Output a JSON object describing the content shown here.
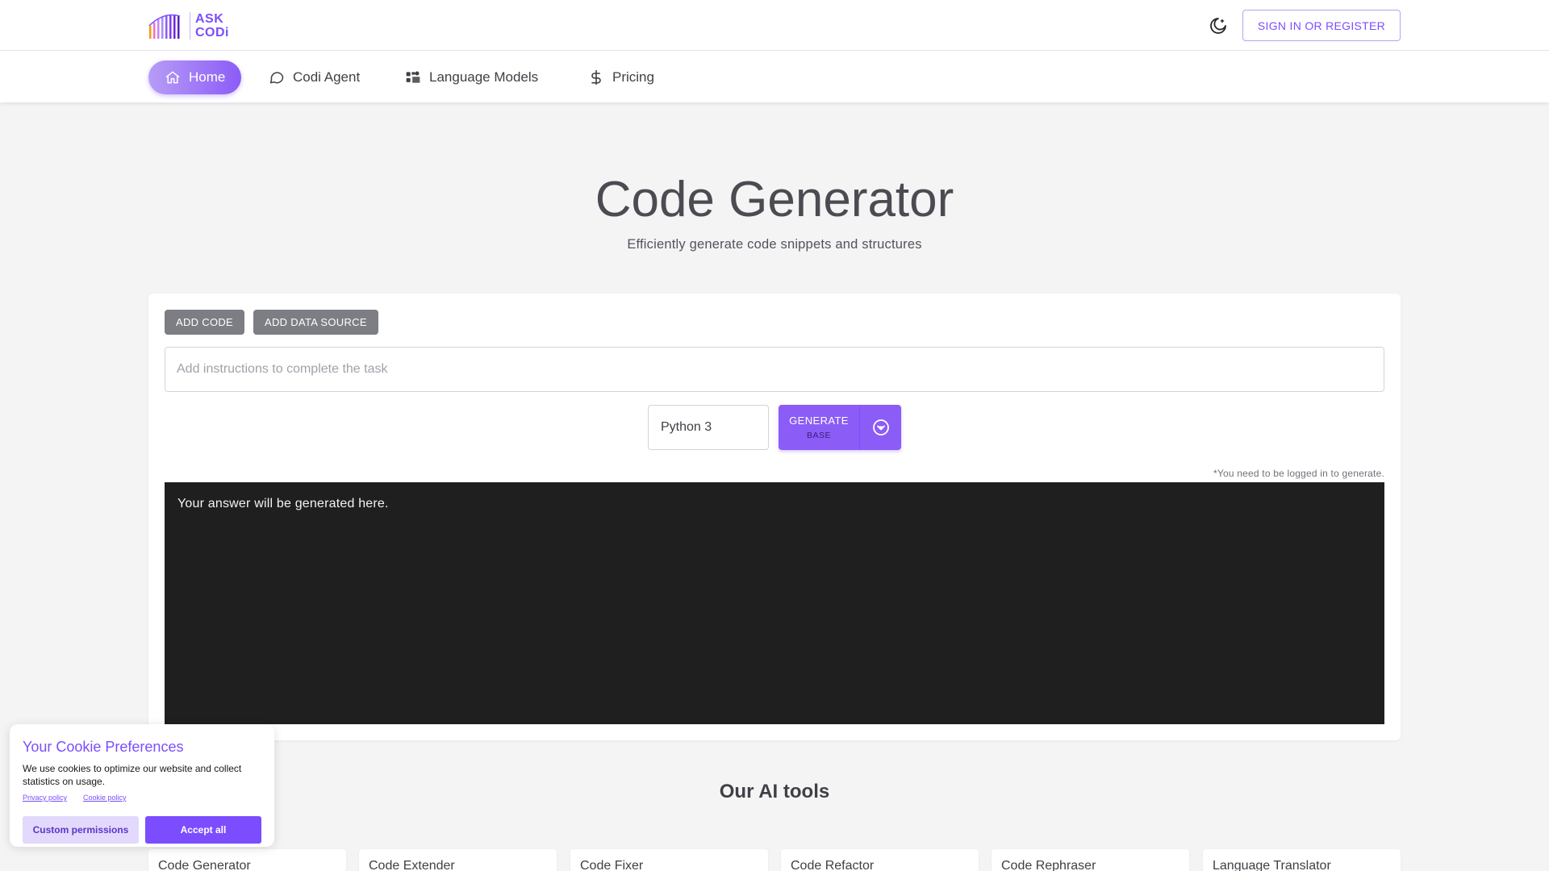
{
  "brand": {
    "logo_line1": "ASK",
    "logo_line2": "CODi",
    "accent_color": "#7c4dff"
  },
  "header": {
    "signin_label": "SIGN IN OR REGISTER",
    "theme_icon": "moon-icon"
  },
  "nav": {
    "items": [
      {
        "label": "Home",
        "icon": "home-icon",
        "active": true
      },
      {
        "label": "Codi Agent",
        "icon": "chat-bubble-icon",
        "active": false
      },
      {
        "label": "Language Models",
        "icon": "models-icon",
        "active": false
      },
      {
        "label": "Pricing",
        "icon": "dollar-icon",
        "active": false
      }
    ]
  },
  "hero": {
    "title": "Code Generator",
    "subtitle": "Efficiently generate code snippets and structures"
  },
  "workspace": {
    "add_code_label": "ADD CODE",
    "add_data_source_label": "ADD DATA SOURCE",
    "instructions_placeholder": "Add instructions to complete the task",
    "instructions_value": "",
    "language_value": "Python 3",
    "generate_label": "GENERATE",
    "generate_mode": "BASE",
    "login_note": "*You need to be logged in to generate.",
    "output_placeholder": "Your answer will be generated here."
  },
  "tools": {
    "heading": "Our AI tools",
    "items": [
      "Code Generator",
      "Code Extender",
      "Code Fixer",
      "Code Refactor",
      "Code Rephraser",
      "Language Translator"
    ]
  },
  "cookie": {
    "title": "Your Cookie Preferences",
    "text": "We use cookies to optimize our website and collect statistics on usage.",
    "privacy_link": "Privacy policy",
    "cookie_link": "Cookie policy",
    "custom_label": "Custom permissions",
    "accept_label": "Accept all"
  }
}
